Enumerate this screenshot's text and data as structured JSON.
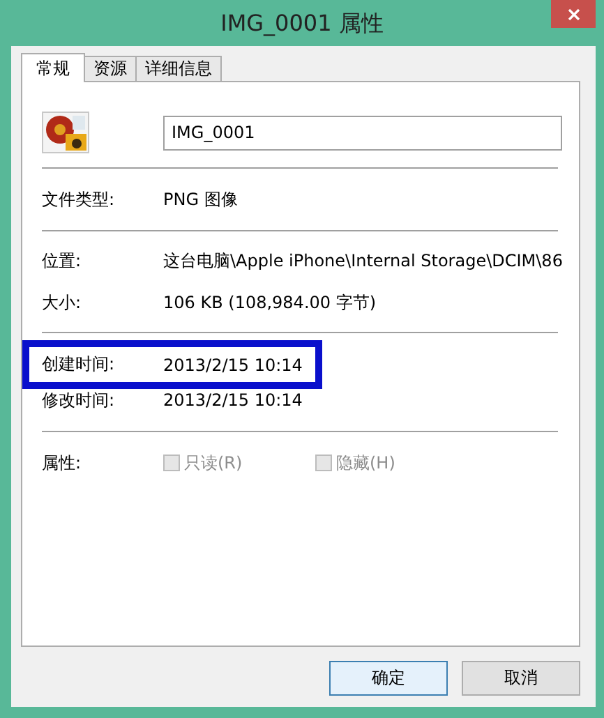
{
  "window": {
    "title": "IMG_0001 属性"
  },
  "tabs": [
    {
      "label": "常规",
      "selected": true
    },
    {
      "label": "资源",
      "selected": false
    },
    {
      "label": "详细信息",
      "selected": false
    }
  ],
  "file_name": {
    "value": "IMG_0001"
  },
  "sections": [
    [
      {
        "label": "文件类型:",
        "value": "PNG 图像",
        "highlighted": false
      }
    ],
    [
      {
        "label": "位置:",
        "value": "这台电脑\\Apple iPhone\\Internal Storage\\DCIM\\86",
        "highlighted": false
      },
      {
        "label": "大小:",
        "value": "106 KB (108,984.00 字节)",
        "highlighted": false
      }
    ],
    [
      {
        "label": "创建时间:",
        "value": "2013/2/15 10:14",
        "highlighted": true
      },
      {
        "label": "修改时间:",
        "value": "2013/2/15 10:14",
        "highlighted": false
      }
    ]
  ],
  "attributes": {
    "label": "属性:",
    "options": [
      {
        "label": "只读(R)",
        "checked": false,
        "disabled": true
      },
      {
        "label": "隐藏(H)",
        "checked": false,
        "disabled": true
      }
    ]
  },
  "buttons": [
    {
      "label": "确定",
      "default": true
    },
    {
      "label": "取消",
      "default": false
    }
  ]
}
